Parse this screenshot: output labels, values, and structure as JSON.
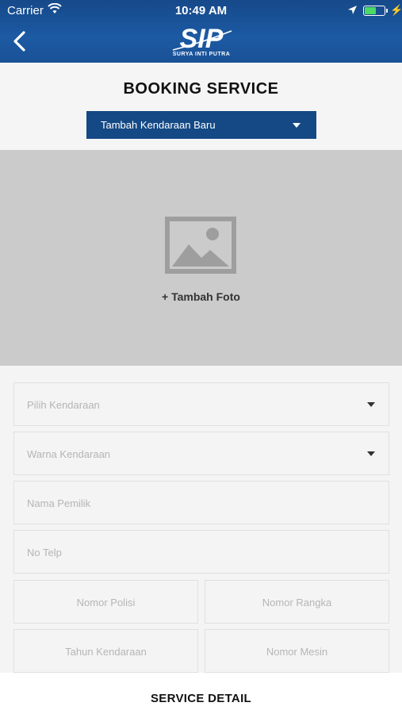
{
  "status_bar": {
    "carrier": "Carrier",
    "time": "10:49 AM",
    "battery_level": 0.6
  },
  "header": {
    "logo_text": "SURYA INTI PUTRA",
    "logo_mark": "SIP"
  },
  "page": {
    "title": "BOOKING SERVICE"
  },
  "vehicle_type": {
    "selected": "Tambah Kendaraan Baru"
  },
  "photo": {
    "add_label": "+ Tambah Foto"
  },
  "form": {
    "pilih_kendaraan": "Pilih Kendaraan",
    "warna_kendaraan": "Warna Kendaraan",
    "nama_pemilik": "Nama Pemilik",
    "no_telp": "No Telp",
    "nomor_polisi": "Nomor Polisi",
    "nomor_rangka": "Nomor Rangka",
    "tahun_kendaraan": "Tahun Kendaraan",
    "nomor_mesin": "Nomor Mesin"
  },
  "footer": {
    "service_detail": "SERVICE DETAIL"
  },
  "colors": {
    "header_blue": "#16498a",
    "dropdown_blue": "#144985",
    "battery_green": "#4cd964"
  }
}
